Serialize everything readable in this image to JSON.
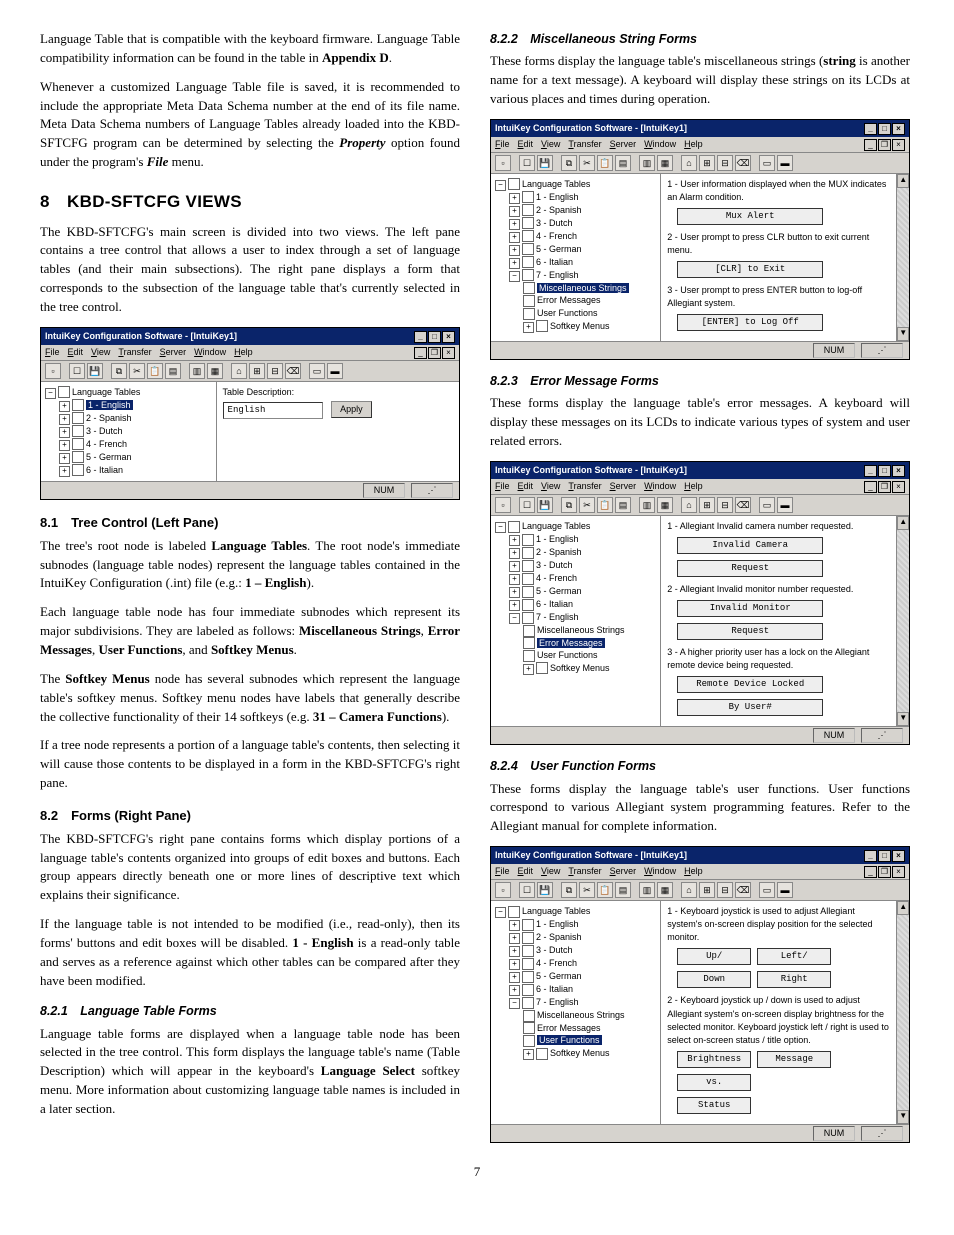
{
  "intro": {
    "p1a": "Language Table that is compatible with the keyboard firmware. Language Table compatibility information can be found in the table in ",
    "p1b": "Appendix D",
    "p1c": ".",
    "p2a": "Whenever a customized Language Table file is saved, it is recommended to include the appropriate Meta Data Schema number at the end of its file name. Meta Data Schema numbers of Language Tables already loaded into the KBD-SFTCFG program can be determined by selecting the ",
    "p2b": "Property",
    "p2c": " option found under the program's ",
    "p2d": "File",
    "p2e": " menu."
  },
  "sec8": {
    "heading": "8 KBD-SFTCFG VIEWS",
    "p1": "The KBD-SFTCFG's main screen is divided into two views. The left pane contains a tree control that allows a user to index through a set of language tables (and their main subsections). The right pane displays a form that corresponds to the subsection of the language table that's currently selected in the tree control."
  },
  "win": {
    "title": "IntuiKey Configuration Software - [IntuiKey1]",
    "menus": [
      "File",
      "Edit",
      "View",
      "Transfer",
      "Server",
      "Window",
      "Help"
    ],
    "rootnode": "Language Tables",
    "langs6": [
      "1 - English",
      "2 - Spanish",
      "3 - Dutch",
      "4 - French",
      "5 - German",
      "6 - Italian"
    ],
    "langs7": [
      "1 - English",
      "2 - Spanish",
      "3 - Dutch",
      "4 - French",
      "5 - German",
      "6 - Italian",
      "7 - English"
    ],
    "subnodes": [
      "Miscellaneous Strings",
      "Error Messages",
      "User Functions",
      "Softkey Menus"
    ],
    "status": "NUM"
  },
  "shot1": {
    "desc_label": "Table Description:",
    "desc_value": "English",
    "apply": "Apply",
    "selected": "1 - English"
  },
  "s81": {
    "heading": "8.1 Tree Control (Left Pane)",
    "p1a": "The tree's root node is labeled ",
    "p1b": "Language Tables",
    "p1c": ". The root node's immediate subnodes (language table nodes) represent the language tables contained in the IntuiKey Configuration (.int) file (e.g.: ",
    "p1d": "1 – English",
    "p1e": ").",
    "p2a": "Each language table node has four immediate subnodes which represent its major subdivisions. They are labeled as follows: ",
    "p2b": "Miscellaneous Strings",
    "p2c": ", ",
    "p2d": "Error Messages",
    "p2e": ", ",
    "p2f": "User Functions",
    "p2g": ", and ",
    "p2h": "Softkey Menus",
    "p2i": ".",
    "p3a": "The ",
    "p3b": "Softkey Menus",
    "p3c": " node has several subnodes which represent the language table's softkey menus. Softkey menu nodes have labels that generally describe the collective functionality of their 14 softkeys (e.g. ",
    "p3d": "31 – Camera Functions",
    "p3e": ").",
    "p4": "If a tree node represents a portion of a language table's contents, then selecting it will cause those contents to be displayed in a form in the KBD-SFTCFG's right pane."
  },
  "s82": {
    "heading": "8.2 Forms (Right Pane)",
    "p1": "The KBD-SFTCFG's right pane contains forms which display portions of a language table's contents organized into groups of edit boxes and buttons. Each group appears directly beneath one or more lines of descriptive text which explains their significance.",
    "p2a": "If the language table is not intended to be modified (i.e., read-only), then its forms' buttons and edit boxes will be disabled. ",
    "p2b": "1 - English",
    "p2c": " is a read-only table and serves as a reference against which other tables can be compared after they have been modified."
  },
  "s821": {
    "heading": "8.2.1 Language Table Forms",
    "p1a": "Language table forms are displayed when a language table node has been selected in the tree control. This form displays the language table's name (Table Description) which will appear in the keyboard's ",
    "p1b": "Language Select",
    "p1c": " softkey menu. More information about customizing language table names is included in a later section."
  },
  "s822": {
    "heading": "8.2.2 Miscellaneous String Forms",
    "p1a": "These forms display the language table's miscellaneous strings (",
    "p1b": "string",
    "p1c": " is another name for a text message). A keyboard will display these strings on its LCDs at various places and times during operation."
  },
  "shot2": {
    "selected": "Miscellaneous Strings",
    "i1": "1 - User information displayed when the MUX indicates an Alarm condition.",
    "l1": "Mux Alert",
    "i2": "2 - User prompt to press CLR button to exit current menu.",
    "l2": "[CLR] to Exit",
    "i3": "3 - User prompt to press ENTER button to log-off Allegiant system.",
    "l3": "[ENTER] to Log Off"
  },
  "s823": {
    "heading": "8.2.3 Error Message Forms",
    "p1": "These forms display the language table's error messages. A keyboard will display these messages on its LCDs to indicate various types of system and user related errors."
  },
  "shot3": {
    "selected": "Error Messages",
    "i1": "1 - Allegiant Invalid camera number requested.",
    "l1a": "Invalid Camera",
    "l1b": "Request",
    "i2": "2 - Allegiant Invalid monitor number requested.",
    "l2a": "Invalid Monitor",
    "l2b": "Request",
    "i3": "3 - A higher priority user has a lock on the Allegiant remote device being requested.",
    "l3a": "Remote Device Locked",
    "l3b": "By User#"
  },
  "s824": {
    "heading": "8.2.4 User Function Forms",
    "p1": "These forms display the language table's user functions. User functions correspond to various Allegiant system programming features. Refer to the Allegiant manual for complete information."
  },
  "shot4": {
    "selected": "User Functions",
    "i1": "1 - Keyboard joystick is used to adjust Allegiant system's on-screen display position for the selected monitor.",
    "l1a": "Up/",
    "l1b": "Left/",
    "l1c": "Down",
    "l1d": "Right",
    "i2": "2 - Keyboard joystick up / down is used to adjust Allegiant system's on-screen display brightness for the selected monitor. Keyboard joystick left / right is used to select on-screen status / title option.",
    "l2a": "Brightness",
    "l2b": "Message",
    "l2c": "vs.",
    "l2d": "Status"
  },
  "page": "7"
}
